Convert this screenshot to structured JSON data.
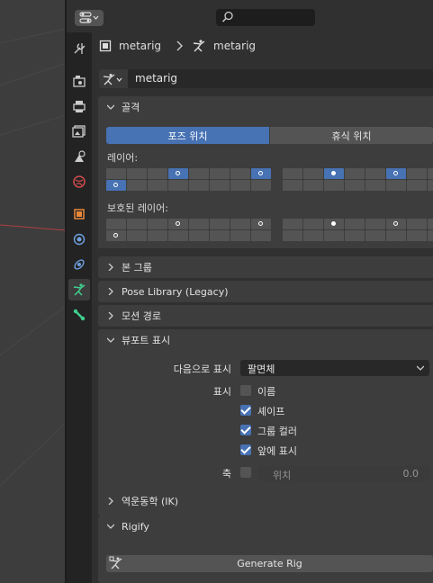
{
  "search": {
    "placeholder": ""
  },
  "breadcrumb": {
    "object": "metarig",
    "data": "metarig"
  },
  "armature_selector": {
    "name": "metarig"
  },
  "skeleton": {
    "title": "골격",
    "pose_position": "포즈 위치",
    "rest_position": "휴식 위치",
    "layers_label": "레이어:",
    "protected_label": "보호된 레이어:"
  },
  "sections": {
    "bone_groups": "본 그룹",
    "pose_library": "Pose Library (Legacy)",
    "motion_paths": "모션 경로",
    "viewport_display": "뷰포트 표시",
    "ik": "역운동학 (IK)",
    "rigify": "Rigify"
  },
  "viewport_display": {
    "display_as_label": "다음으로 표시",
    "display_as_value": "팔면체",
    "show_label": "표시",
    "names": {
      "label": "이름",
      "checked": false
    },
    "shapes": {
      "label": "셰이프",
      "checked": true
    },
    "group_colors": {
      "label": "그룹 컬러",
      "checked": true
    },
    "in_front": {
      "label": "앞에 표시",
      "checked": true
    },
    "axes_label": "축",
    "axes_checked": false,
    "position_label": "위치",
    "position_value": "0.0"
  },
  "rigify": {
    "generate_label": "Generate Rig"
  },
  "colors": {
    "accent": "#4772b3",
    "panel": "#3d3d3d",
    "background": "#303030",
    "tab_active_icon": "#3fcf8e"
  }
}
